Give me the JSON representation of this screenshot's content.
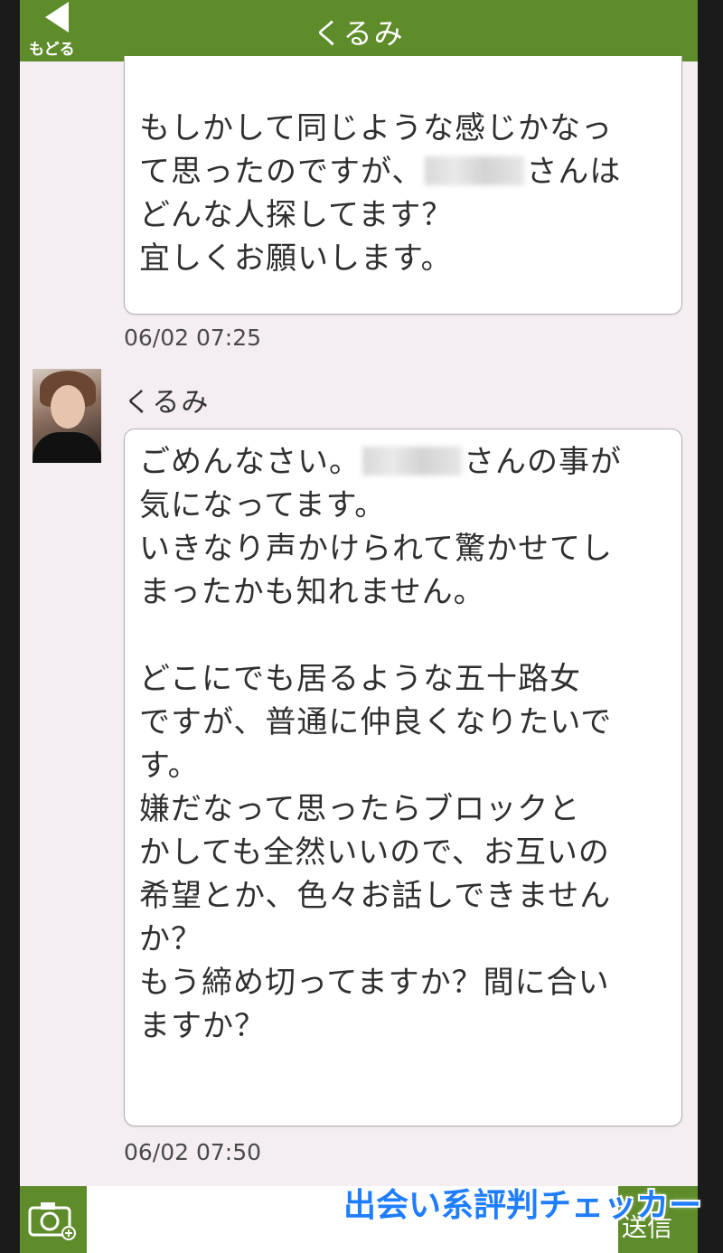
{
  "header": {
    "back_label": "もどる",
    "title": "くるみ"
  },
  "messages": [
    {
      "lines": [
        {
          "text": "もしかして同じような感じかなっ"
        },
        {
          "before": "て思ったのですが、",
          "after": "さんは"
        },
        {
          "text": "どんな人探してます？"
        },
        {
          "text": "宜しくお願いします。"
        }
      ],
      "timestamp": "06/02 07:25"
    },
    {
      "sender": "くるみ",
      "lines": [
        {
          "before": "ごめんなさい。",
          "after": "さんの事が"
        },
        {
          "text": "気になってます。"
        },
        {
          "text": "いきなり声かけられて驚かせてし"
        },
        {
          "text": "まったかも知れません。"
        },
        {
          "text": ""
        },
        {
          "text": "どこにでも居るような五十路女"
        },
        {
          "text": "ですが、普通に仲良くなりたいで"
        },
        {
          "text": "す。"
        },
        {
          "text": "嫌だなって思ったらブロックと"
        },
        {
          "text": "かしても全然いいので、お互いの"
        },
        {
          "text": "希望とか、色々お話しできません"
        },
        {
          "text": "か？"
        },
        {
          "text": "もう締め切ってますか？間に合い"
        },
        {
          "text": "ますか？"
        }
      ],
      "timestamp": "06/02 07:50"
    }
  ],
  "bottom_bar": {
    "camera_icon": "camera-icon",
    "send_label": "送信"
  },
  "watermark": "出会い系評判チェッカー",
  "colors": {
    "header_green": "#5e8c2b",
    "background": "#f4eef3",
    "watermark_blue": "#1f7dff"
  }
}
